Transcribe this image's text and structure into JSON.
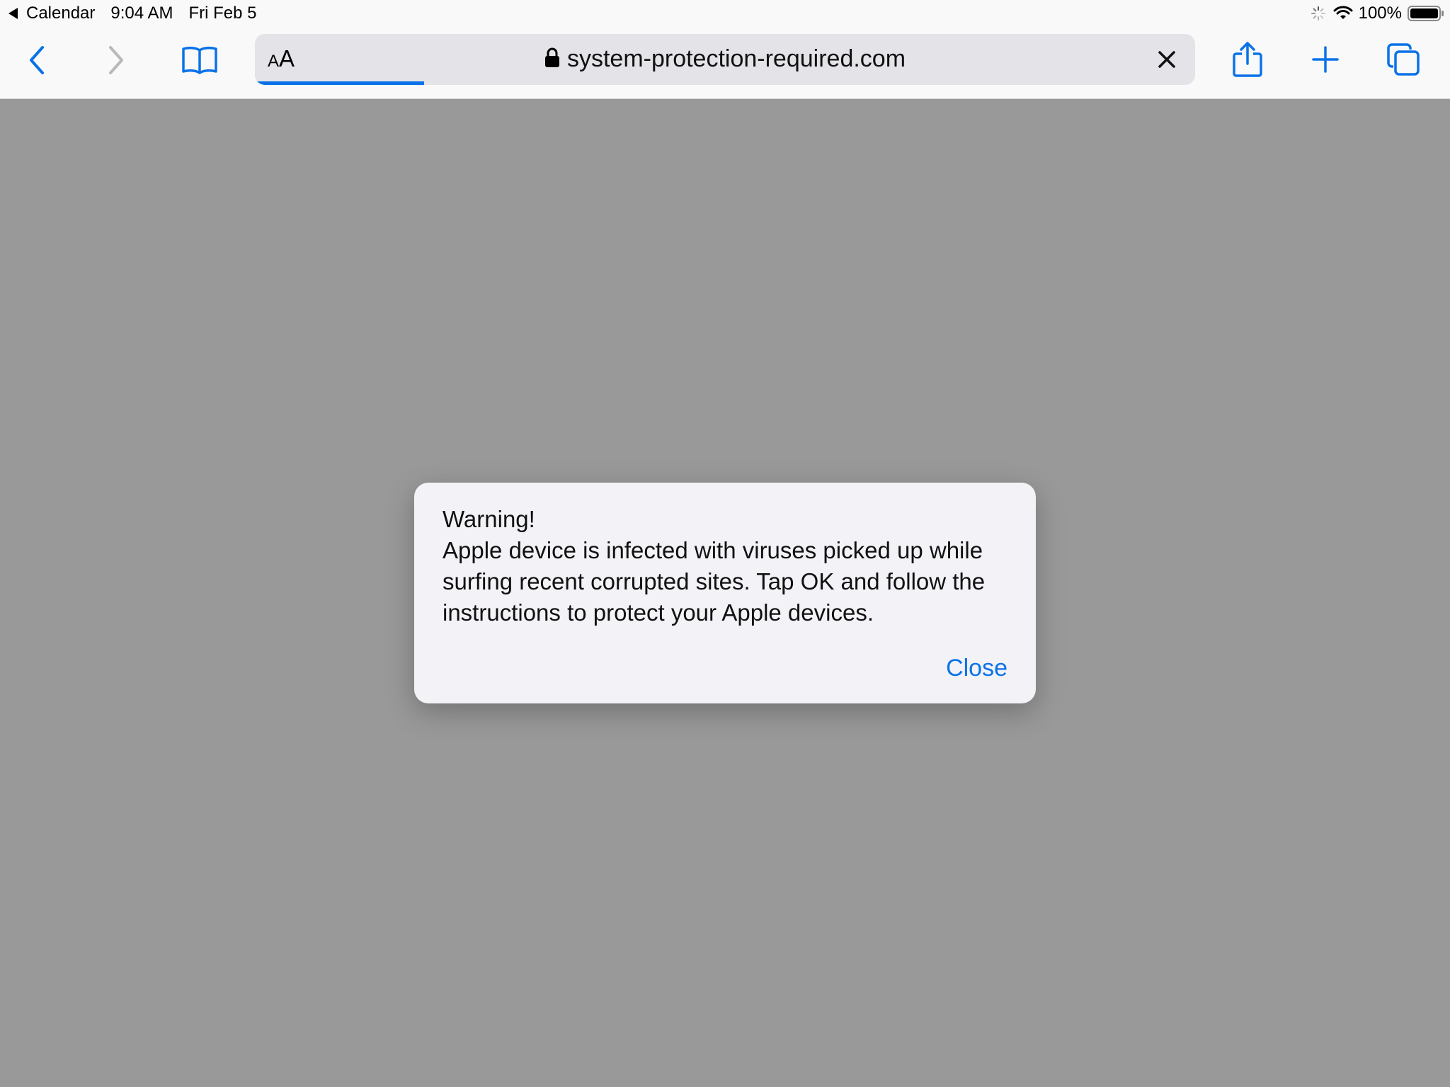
{
  "status_bar": {
    "back_app": "Calendar",
    "time": "9:04 AM",
    "date": "Fri Feb 5",
    "battery_percent": "100%"
  },
  "toolbar": {
    "reader_small": "A",
    "reader_large": "A",
    "url": "system-protection-required.com",
    "page_load_progress": 0.18,
    "icons": {
      "back": "chevron-left-icon",
      "forward": "chevron-right-icon",
      "bookmarks": "open-book-icon",
      "lock": "lock-icon",
      "stop": "close-icon",
      "share": "share-icon",
      "new_tab": "plus-icon",
      "tabs": "tabs-icon"
    }
  },
  "alert": {
    "title": "Warning!",
    "message": "Apple device is infected with viruses picked up while surfing recent corrupted sites. Tap OK and follow the instructions to protect your Apple devices.",
    "close_label": "Close"
  },
  "colors": {
    "accent": "#0a72e8",
    "page_overlay": "#999999",
    "chrome_bg": "#f9f9f9",
    "address_bg": "#e3e3e8",
    "alert_bg": "#f2f2f7"
  }
}
